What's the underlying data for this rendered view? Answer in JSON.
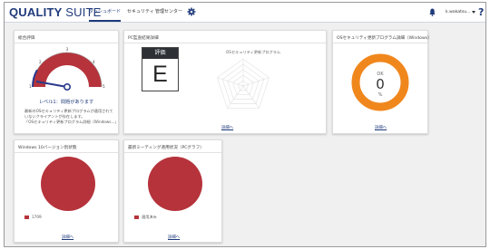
{
  "header": {
    "logo_bold": "QUALITY",
    "logo_rest": " SUITE",
    "nav": [
      "ダッシュボード",
      "セキュリティ",
      "管理センター"
    ],
    "user": "k.wakatsu..."
  },
  "cards": {
    "overall": {
      "title": "総合評価",
      "gauge_level": 1,
      "gauge_ticks": [
        "1",
        "2",
        "3",
        "4",
        "5"
      ],
      "level_text": "レベル1：問題があります",
      "desc": [
        "最新のOSセキュリティ更新プログラムが適用されて",
        "いないクライアントが存在します。",
        "「OSセキュリティ更新プログラム詳細（Windows...」"
      ]
    },
    "pc": {
      "title": "PC監査結果詳細",
      "eval_label": "評価",
      "eval_value": "E",
      "radar_label": "OSセキュリティ更新プログラム",
      "link": "詳細へ"
    },
    "os": {
      "title": "OSセキュリティ更新プログラム詳細（Windows）",
      "status": "OK",
      "value": "0",
      "unit": "%",
      "link": "詳細へ"
    },
    "winver": {
      "title": "Windows 10バージョン別状態",
      "legend": "1709",
      "link": "詳細へ"
    },
    "ms": {
      "title": "最新ミーティング適用状況（PCグラフ）",
      "legend": "適用済み",
      "link": "詳細へ"
    }
  },
  "colors": {
    "brand": "#1f3a7a",
    "gauge": "#b6333b",
    "donut": "#f0871d",
    "pie": "#b6333b"
  }
}
